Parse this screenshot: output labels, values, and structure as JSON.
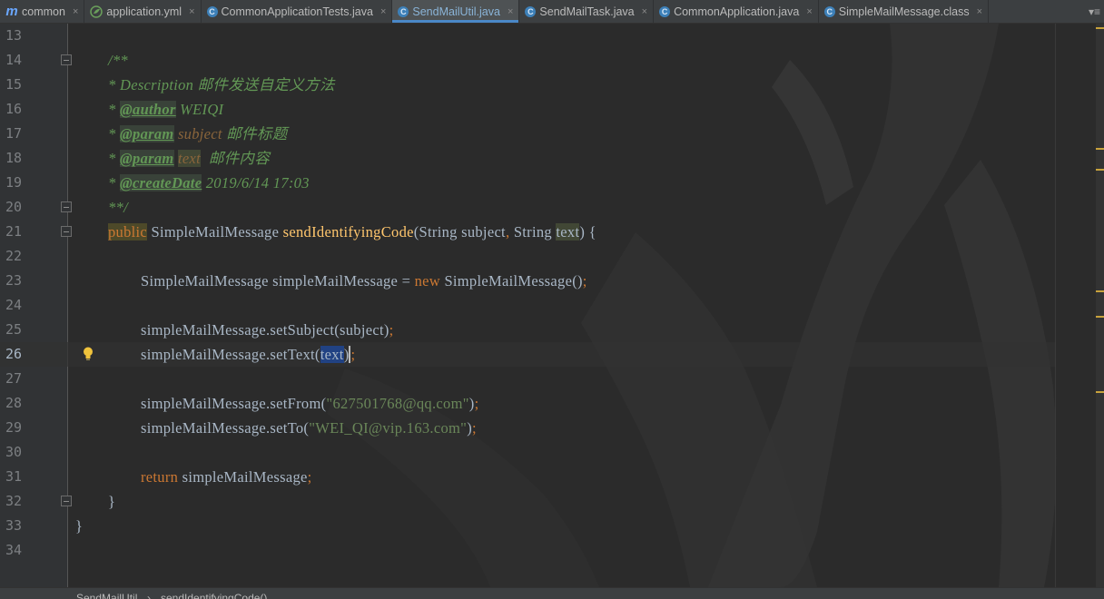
{
  "tabs": [
    {
      "label": "common",
      "icon": "module-m-icon",
      "active": false
    },
    {
      "label": "application.yml",
      "icon": "spring-leaf-icon",
      "active": false
    },
    {
      "label": "CommonApplicationTests.java",
      "icon": "class-c-icon",
      "active": false
    },
    {
      "label": "SendMailUtil.java",
      "icon": "class-c-icon",
      "active": true
    },
    {
      "label": "SendMailTask.java",
      "icon": "class-c-icon",
      "active": false
    },
    {
      "label": "CommonApplication.java",
      "icon": "class-c-icon",
      "active": false
    },
    {
      "label": "SimpleMailMessage.class",
      "icon": "class-c-icon",
      "active": false
    }
  ],
  "tab_close_glyph": "×",
  "tab_menu_glyph": "▾≡",
  "lines": [
    "13",
    "14",
    "15",
    "16",
    "17",
    "18",
    "19",
    "20",
    "21",
    "22",
    "23",
    "24",
    "25",
    "26",
    "27",
    "28",
    "29",
    "30",
    "31",
    "32",
    "33",
    "34"
  ],
  "code": {
    "l14": "/**",
    "l15": "* Description 邮件发送自定义方法",
    "l16_star": "* ",
    "l16_tag": "@author",
    "l16_rest": " WEIQI",
    "l17_star": "* ",
    "l17_tag": "@param",
    "l17_name": " subject",
    "l17_rest": " 邮件标题",
    "l18_star": "* ",
    "l18_tag": "@param",
    "l18_name": "text",
    "l18_rest": "  邮件内容",
    "l19_star": "* ",
    "l19_tag": "@createDate",
    "l19_rest": " 2019/6/14 17:03",
    "l20": "**/",
    "l21_public": "public",
    "l21_type": " SimpleMailMessage ",
    "l21_method": "sendIdentifyingCode",
    "l21_args1": "(String subject",
    "l21_comma": ",",
    "l21_args2": " String ",
    "l21_text": "text",
    "l21_end": ") {",
    "l23_a": "SimpleMailMessage simpleMailMessage = ",
    "l23_new": "new",
    "l23_b": " SimpleMailMessage()",
    "l23_semi": ";",
    "l25_a": "simpleMailMessage.setSubject(subject)",
    "l25_semi": ";",
    "l26_a": "simpleMailMessage.setText(",
    "l26_sel": "text",
    "l26_b": ")",
    "l26_semi": ";",
    "l28_a": "simpleMailMessage.setFrom(",
    "l28_str": "\"627501768@qq.com\"",
    "l28_b": ")",
    "l28_semi": ";",
    "l29_a": "simpleMailMessage.setTo(",
    "l29_str": "\"WEI_QI@vip.163.com\"",
    "l29_b": ")",
    "l29_semi": ";",
    "l31_ret": "return",
    "l31_b": " simpleMailMessage",
    "l31_semi": ";",
    "l32": "}",
    "l33": "}"
  },
  "breadcrumb": {
    "class": "SendMailUtil",
    "separator": "›",
    "method": "sendIdentifyingCode()"
  },
  "colors": {
    "background": "#2b2b2b",
    "keyword": "#cc7832",
    "method": "#ffc66d",
    "doc_comment": "#629755",
    "string": "#6a8759",
    "selection": "#214283",
    "active_tab_underline": "#4a88c7"
  }
}
